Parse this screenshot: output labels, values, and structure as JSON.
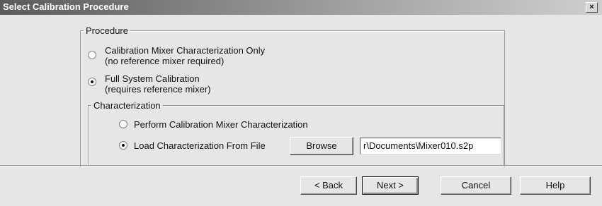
{
  "window": {
    "title": "Select Calibration Procedure",
    "close_glyph": "×"
  },
  "procedure": {
    "legend": "Procedure",
    "options": [
      {
        "line1": "Calibration Mixer Characterization Only",
        "line2": "(no reference mixer required)",
        "checked": false
      },
      {
        "line1": "Full System Calibration",
        "line2": "(requires reference mixer)",
        "checked": true
      }
    ]
  },
  "characterization": {
    "legend": "Characterization",
    "options": [
      {
        "label": "Perform Calibration Mixer Characterization",
        "checked": false
      },
      {
        "label": "Load Characterization From File",
        "checked": true
      }
    ],
    "browse_label": "Browse",
    "file_value": "r\\Documents\\Mixer010.s2p"
  },
  "buttons": {
    "back": "< Back",
    "next": "Next >",
    "cancel": "Cancel",
    "help": "Help"
  }
}
